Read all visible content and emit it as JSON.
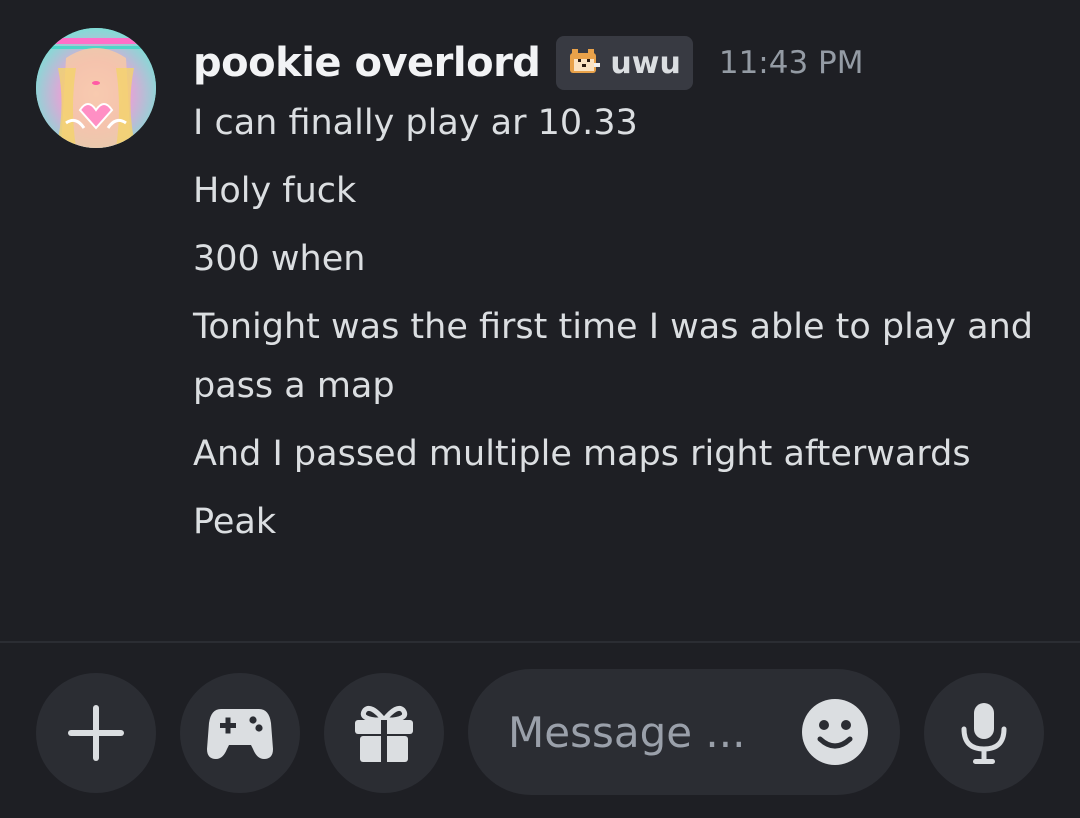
{
  "message": {
    "author": "pookie overlord",
    "tag": {
      "label": "uwu",
      "icon": "shiba-dog-icon"
    },
    "timestamp": "11:43 PM",
    "lines": [
      "I can finally play ar 10.33",
      "Holy fuck",
      "300 when",
      "Tonight was the first time I was able to play and pass a map",
      "And I passed multiple maps right afterwards",
      "Peak"
    ]
  },
  "composer": {
    "placeholder": "Message ...",
    "buttons": [
      "plus-icon",
      "gamepad-icon",
      "gift-icon",
      "emoji-icon",
      "microphone-icon"
    ]
  },
  "colors": {
    "background": "#1e1f24",
    "button": "#2b2d33",
    "text": "#dbdee1",
    "muted": "#949ba4"
  }
}
